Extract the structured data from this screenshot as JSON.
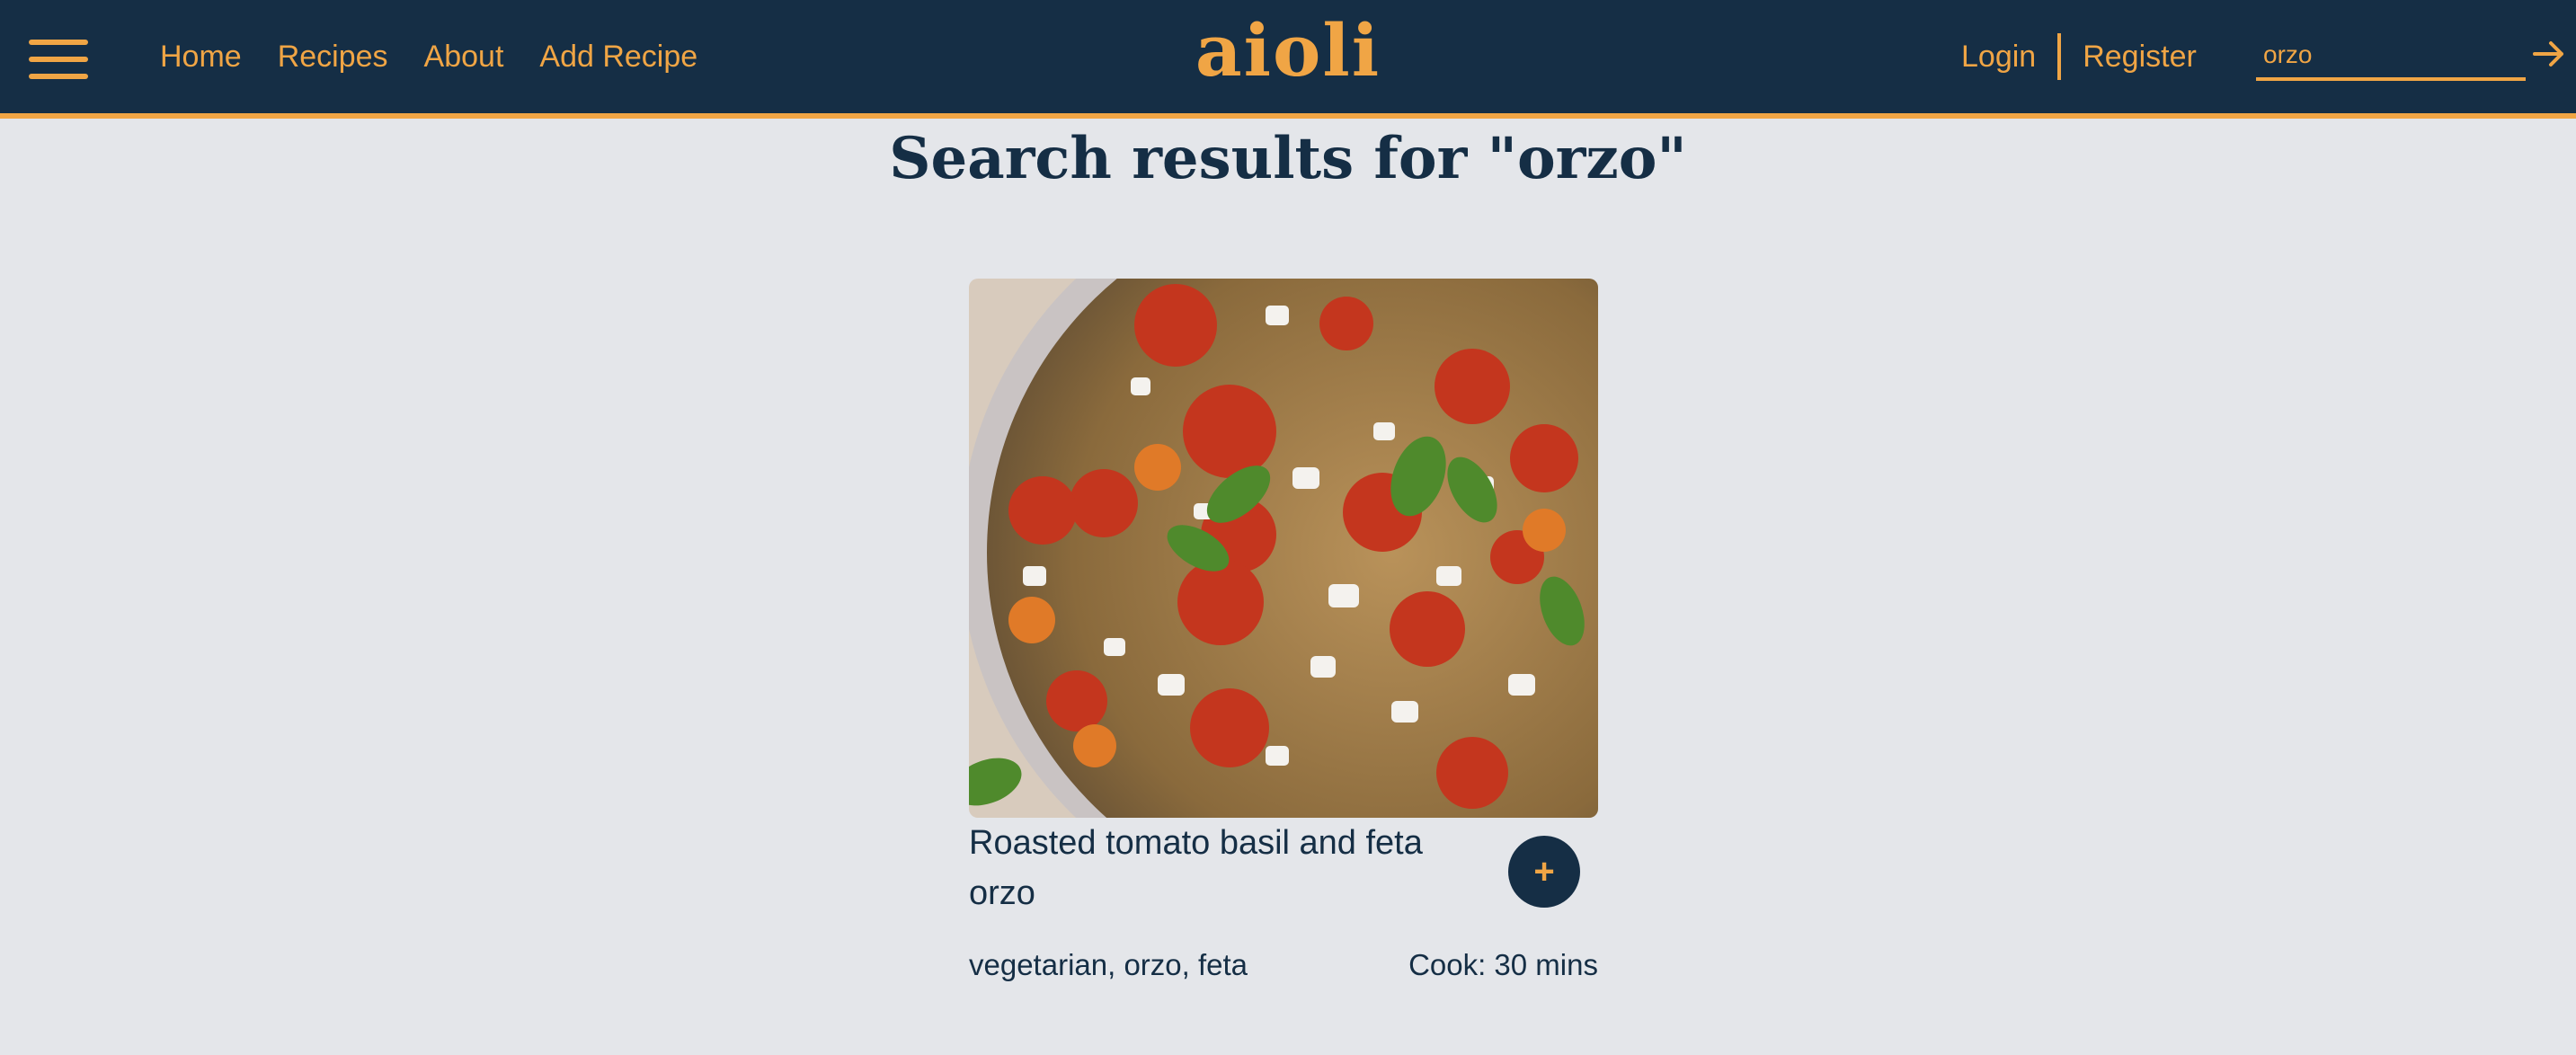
{
  "colors": {
    "navbar_bg": "#152e45",
    "accent": "#f0a545",
    "page_bg": "#e4e6ea",
    "text_dark": "#152e45"
  },
  "nav": {
    "menu_icon": "hamburger-menu-icon",
    "links": [
      "Home",
      "Recipes",
      "About",
      "Add Recipe"
    ],
    "logo": "aioli",
    "login": "Login",
    "register": "Register",
    "search_value": "orzo",
    "search_icon": "arrow-right-icon"
  },
  "page": {
    "title": "Search results for \"orzo\""
  },
  "results": [
    {
      "title": "Roasted tomato basil and feta orzo",
      "add_label": "+",
      "tags": "vegetarian, orzo, feta",
      "cook_time": "Cook: 30 mins"
    }
  ]
}
